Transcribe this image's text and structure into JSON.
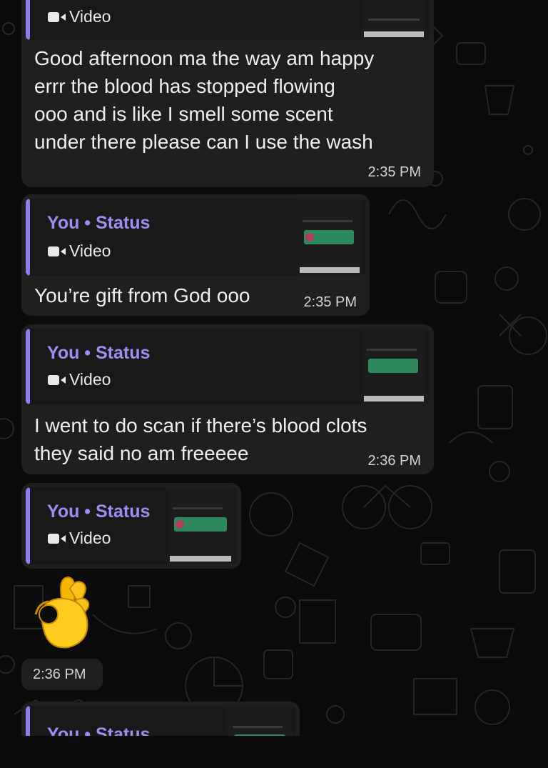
{
  "messages": [
    {
      "quote": {
        "type": "Video"
      },
      "text_lines": [
        "Good afternoon ma the way am happy",
        "errr the blood has stopped flowing",
        "ooo and is like I smell some scent",
        "under there please can I use the wash"
      ],
      "time": "2:35 PM"
    },
    {
      "quote": {
        "title": "You • Status",
        "type": "Video"
      },
      "text_lines": [
        "You’re gift from God ooo"
      ],
      "time": "2:35 PM"
    },
    {
      "quote": {
        "title": "You • Status",
        "type": "Video"
      },
      "text_lines": [
        "I went to do scan if there’s blood clots",
        "they said no am freeeee"
      ],
      "time": "2:36 PM"
    },
    {
      "quote": {
        "title": "You • Status",
        "type": "Video"
      }
    },
    {
      "emoji": "👌",
      "time": "2:36 PM"
    },
    {
      "quote": {
        "title": "You • Status"
      }
    }
  ],
  "colors": {
    "background": "#0b0b0b",
    "bubble": "#1f1f1f",
    "quote_bg": "#191919",
    "accent": "#8e7cf0",
    "status_title": "#9b8ff3"
  },
  "icons": [
    "video-camera-icon",
    "ok-hand-emoji"
  ]
}
